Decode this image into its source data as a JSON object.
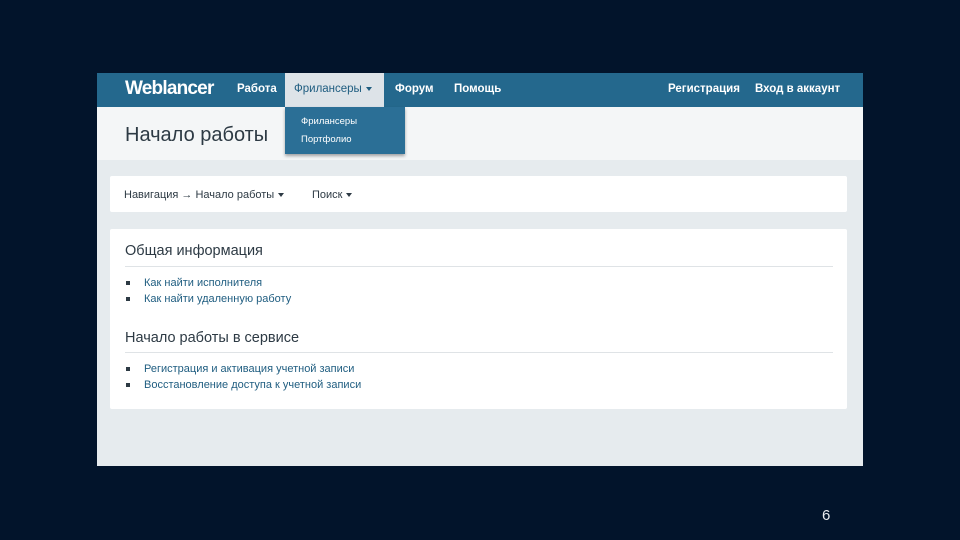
{
  "nav": {
    "logo": "Weblancer",
    "items": [
      "Работа",
      "Фриланcеры",
      "Форум",
      "Помощь"
    ],
    "right": [
      "Регистрация",
      "Вход в аккаунт"
    ]
  },
  "dropdown": {
    "items": [
      "Фрилансеры",
      "Портфолио"
    ]
  },
  "header": {
    "title": "Начало работы"
  },
  "breadcrumb": {
    "path": "Навигация → Начало работы",
    "search": "Поиск"
  },
  "sections": [
    {
      "title": "Общая информация",
      "links": [
        "Как найти исполнителя",
        "Как найти удаленную работу"
      ]
    },
    {
      "title": "Начало работы в сервисе",
      "links": [
        "Регистрация и активация учетной записи",
        "Восстановление доступа к учетной записи"
      ]
    }
  ],
  "slide_number": "6",
  "colors": {
    "nav_bg": "#24688d",
    "dropdown_bg": "#2b6f96",
    "link": "#1f5d80",
    "page_bg": "#02142b"
  }
}
